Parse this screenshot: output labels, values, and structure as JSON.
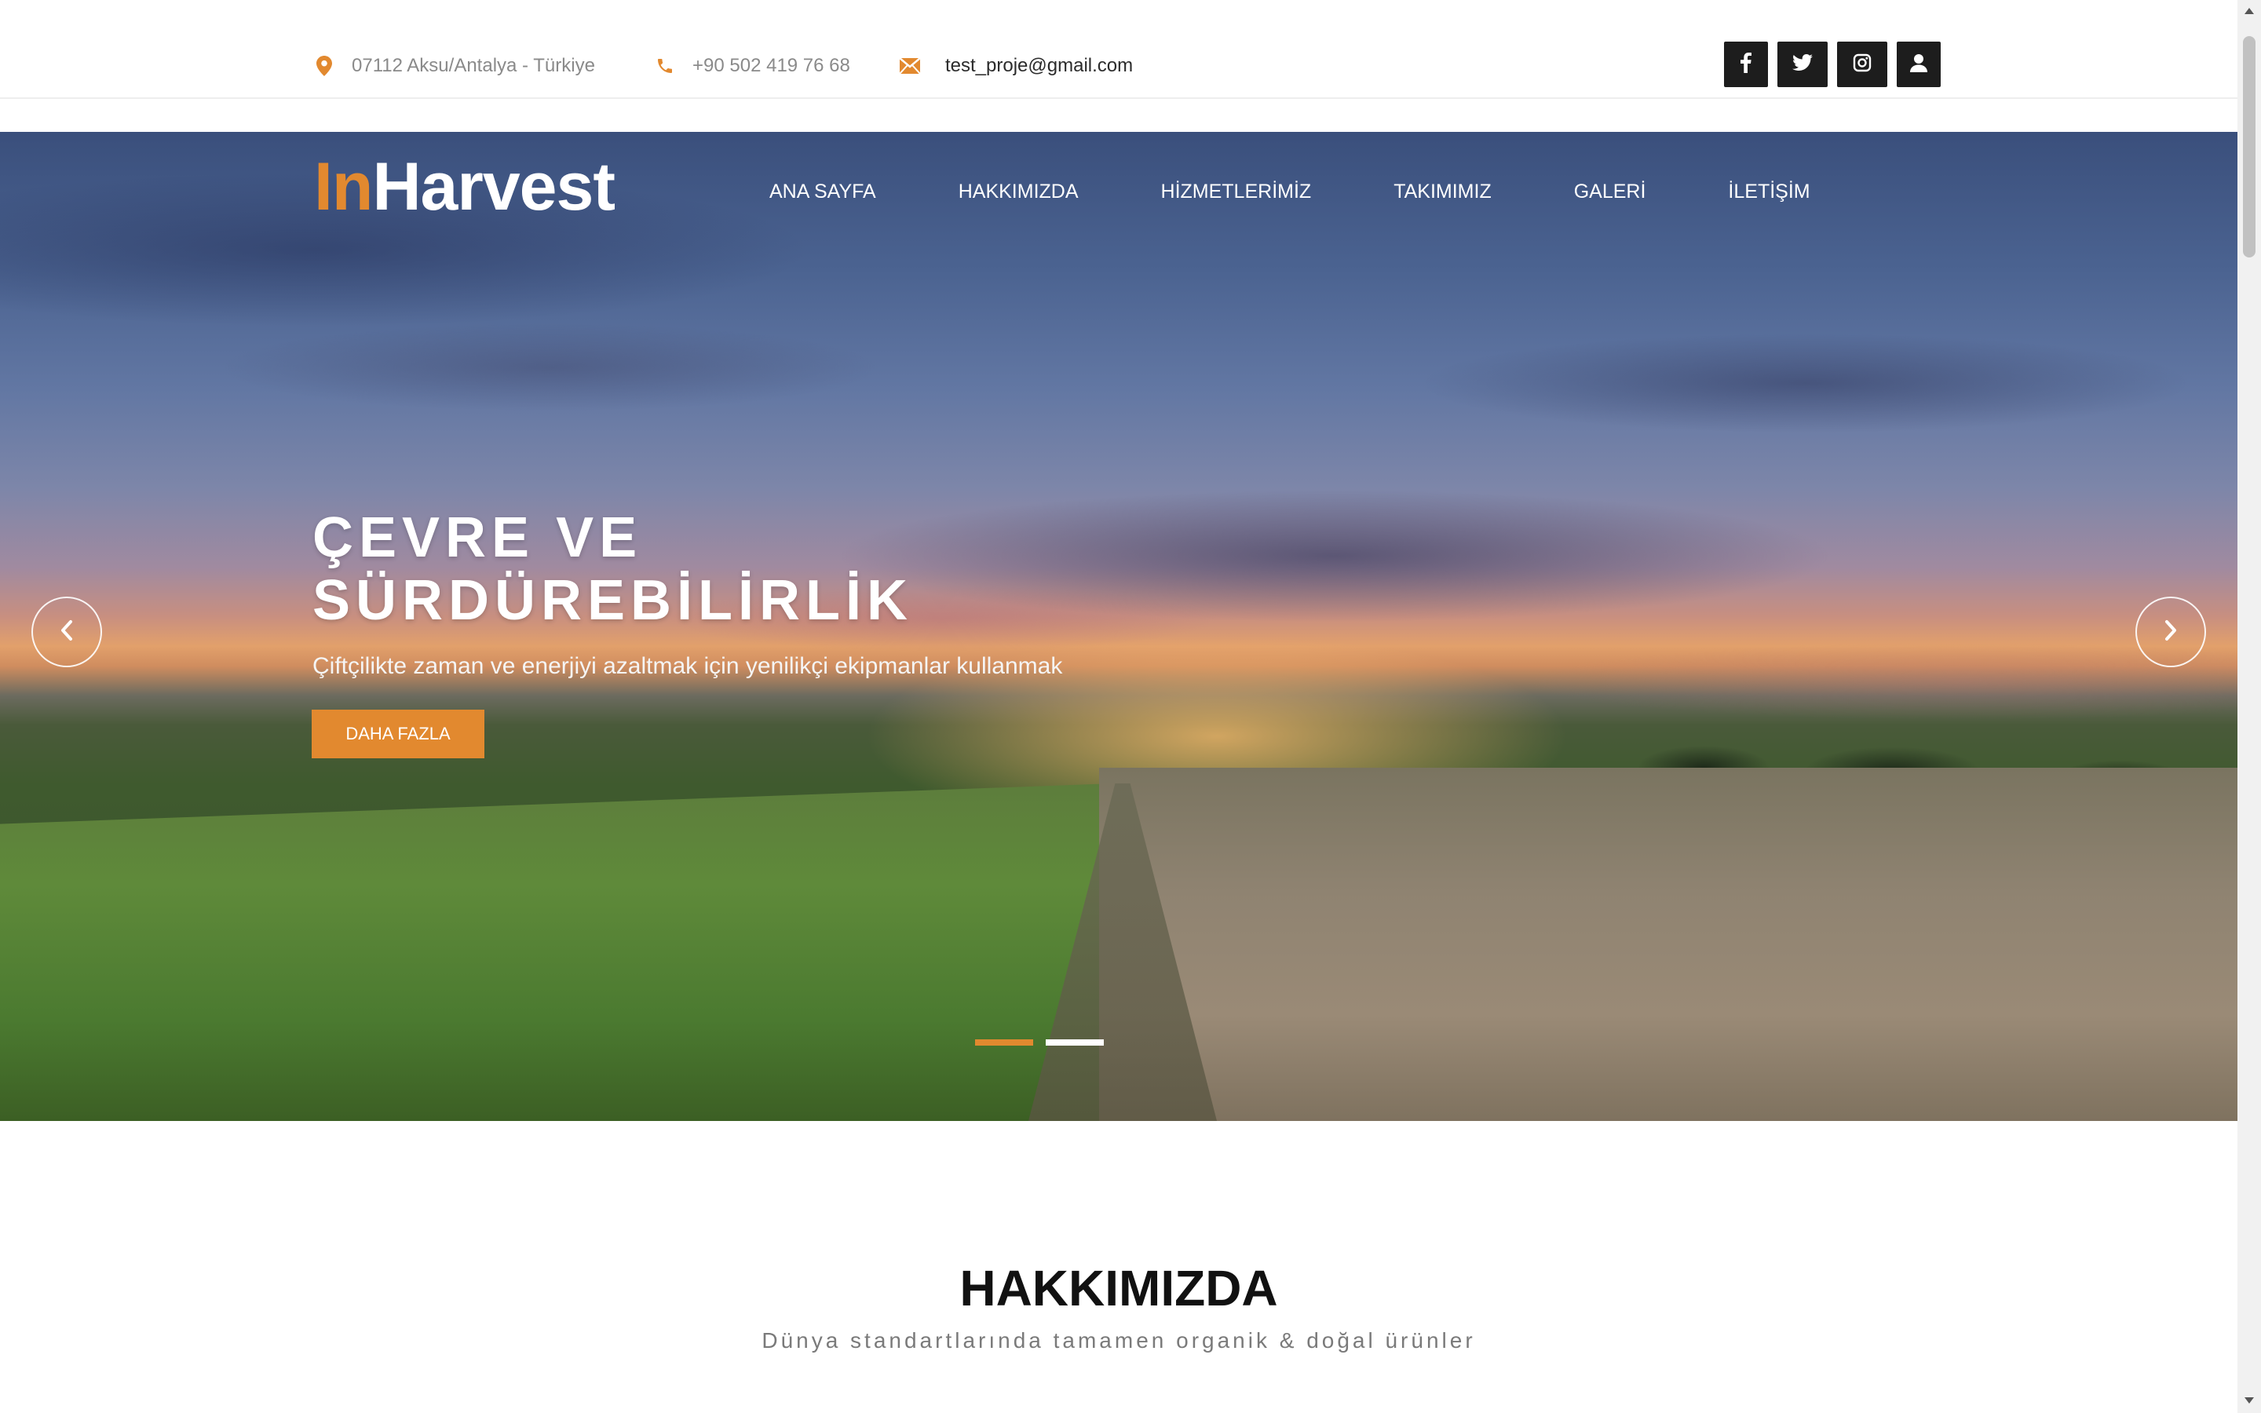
{
  "topbar": {
    "address": "07112 Aksu/Antalya - Türkiye",
    "phone": "+90 502 419 76 68",
    "email": "test_proje@gmail.com",
    "icons": {
      "address": "map-pin-icon",
      "phone": "phone-icon",
      "email": "envelope-icon"
    },
    "socials": [
      "facebook-icon",
      "twitter-icon",
      "instagram-icon",
      "user-icon"
    ]
  },
  "brand": {
    "part1": "In",
    "part2": "Harvest"
  },
  "nav": {
    "items": [
      "ANA SAYFA",
      "HAKKIMIZDA",
      "HİZMETLERİMİZ",
      "TAKIMIMIZ",
      "GALERİ",
      "İLETİŞİM"
    ]
  },
  "hero": {
    "title": "ÇEVRE VE SÜRDÜREBİLİRLİK",
    "subtitle": "Çiftçilikte zaman ve enerjiyi azaltmak için yenilikçi ekipmanlar kullanmak",
    "button": "DAHA FAZLA",
    "slides_total": 2,
    "active_slide": 1
  },
  "about": {
    "title": "HAKKIMIZDA",
    "subtitle": "Dünya standartlarında tamamen organik & doğal ürünler"
  },
  "colors": {
    "accent": "#e2892f",
    "dark": "#1d1d1d"
  }
}
